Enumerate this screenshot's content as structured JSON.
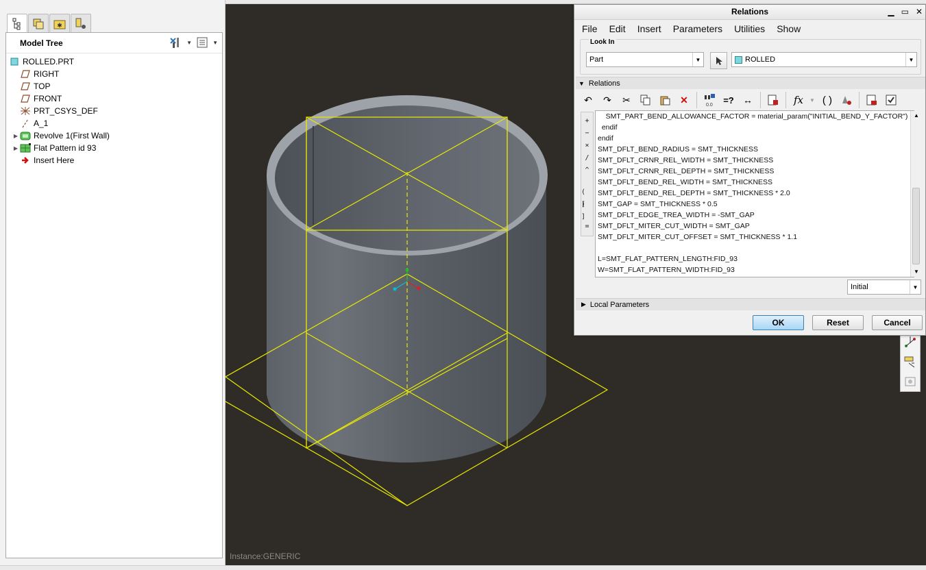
{
  "model_tree": {
    "title": "Model Tree",
    "items": [
      {
        "label": "ROLLED.PRT",
        "icon": "part-icon"
      },
      {
        "label": "RIGHT",
        "icon": "datum-plane-icon"
      },
      {
        "label": "TOP",
        "icon": "datum-plane-icon"
      },
      {
        "label": "FRONT",
        "icon": "datum-plane-icon"
      },
      {
        "label": "PRT_CSYS_DEF",
        "icon": "coordinate-system-icon"
      },
      {
        "label": "A_1",
        "icon": "datum-axis-icon"
      },
      {
        "label": "Revolve 1(First Wall)",
        "icon": "sheetmetal-wall-icon"
      },
      {
        "label": "Flat Pattern id 93",
        "icon": "flat-pattern-icon"
      },
      {
        "label": "Insert Here",
        "icon": "insert-arrow-icon"
      }
    ]
  },
  "viewport": {
    "instance_label": "Instance:GENERIC"
  },
  "dialog": {
    "title": "Relations",
    "menu": [
      "File",
      "Edit",
      "Insert",
      "Parameters",
      "Utilities",
      "Show"
    ],
    "look_in": {
      "legend": "Look In",
      "type_value": "Part",
      "object_value": "ROLLED"
    },
    "relations_section": "Relations",
    "operators": [
      "+",
      "−",
      "×",
      "/",
      "^",
      "( )",
      "[ ]",
      "="
    ],
    "editor_lines": [
      "    SMT_PART_BEND_ALLOWANCE_FACTOR = material_param(\"INITIAL_BEND_Y_FACTOR\")",
      "  endif",
      "endif",
      "SMT_DFLT_BEND_RADIUS = SMT_THICKNESS",
      "SMT_DFLT_CRNR_REL_WIDTH = SMT_THICKNESS",
      "SMT_DFLT_CRNR_REL_DEPTH = SMT_THICKNESS",
      "SMT_DFLT_BEND_REL_WIDTH = SMT_THICKNESS",
      "SMT_DFLT_BEND_REL_DEPTH = SMT_THICKNESS * 2.0",
      "SMT_GAP = SMT_THICKNESS * 0.5",
      "SMT_DFLT_EDGE_TREA_WIDTH = -SMT_GAP",
      "SMT_DFLT_MITER_CUT_WIDTH = SMT_GAP",
      "SMT_DFLT_MITER_CUT_OFFSET = SMT_THICKNESS * 1.1",
      "",
      "L=SMT_FLAT_PATTERN_LENGTH:FID_93",
      "W=SMT_FLAT_PATTERN_WIDTH:FID_93"
    ],
    "initial_value": "Initial",
    "local_parameters": "Local Parameters",
    "ok_label": "OK",
    "reset_label": "Reset",
    "cancel_label": "Cancel"
  },
  "colors": {
    "viewport_bg": "#2f2c27",
    "datum_yellow": "#e8e800",
    "ok_button": "#a9d6f5"
  }
}
